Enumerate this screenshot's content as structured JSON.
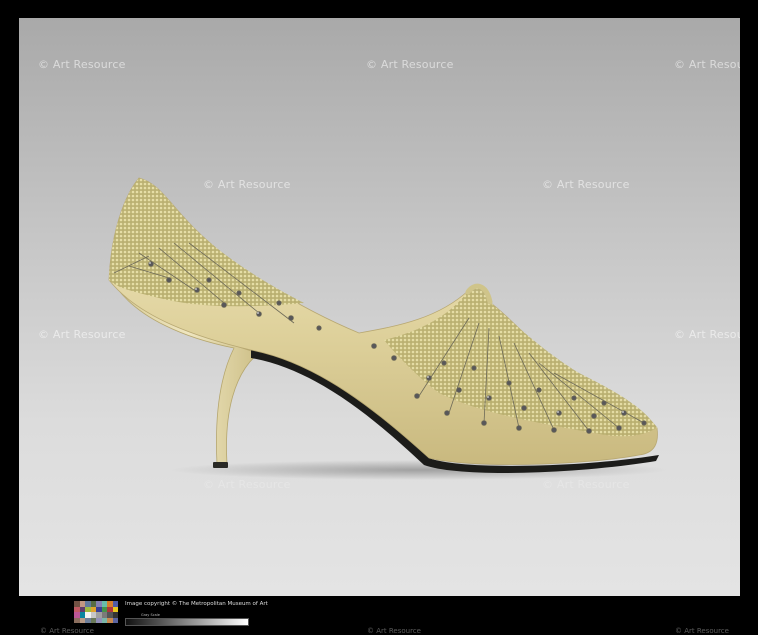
{
  "watermark": {
    "text": "© Art Resource"
  },
  "footer": {
    "copyright": "Image copyright © The Metropolitan Museum of Art",
    "scale_label": "Gray Scale"
  },
  "colors": {
    "satin": "#e3d8a6",
    "beads": "#c9bf7a",
    "sole": "#1c1c1a"
  },
  "icons": [
    "color-checker-card",
    "grayscale-strip"
  ]
}
